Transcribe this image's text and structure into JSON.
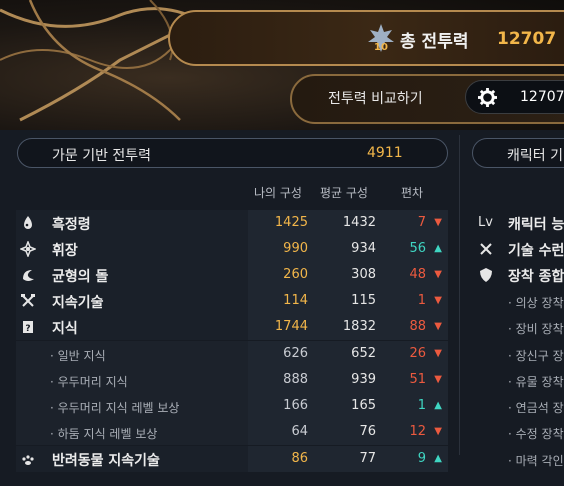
{
  "header": {
    "title_label": "총 전투력",
    "title_value": "12707",
    "emblem_badge": "10",
    "compare_label": "전투력 비교하기",
    "compare_value": "12707"
  },
  "family": {
    "label": "가문 기반 전투력",
    "value": "4911"
  },
  "character": {
    "label": "캐릭터 기"
  },
  "columns": {
    "mine": "나의 구성",
    "avg": "평균 구성",
    "dev": "편차"
  },
  "rows": [
    {
      "name": "흑정령",
      "icon": "spirit-flame-icon",
      "mine": "1425",
      "avg": "1432",
      "dev": "7",
      "dir": "down"
    },
    {
      "name": "휘장",
      "icon": "emblem-icon",
      "mine": "990",
      "avg": "934",
      "dev": "56",
      "dir": "up"
    },
    {
      "name": "균형의 돌",
      "icon": "balance-stone-icon",
      "mine": "260",
      "avg": "308",
      "dev": "48",
      "dir": "down"
    },
    {
      "name": "지속기술",
      "icon": "crossed-tools-icon",
      "mine": "114",
      "avg": "115",
      "dev": "1",
      "dir": "down"
    },
    {
      "name": "지식",
      "icon": "knowledge-book-icon",
      "mine": "1744",
      "avg": "1832",
      "dev": "88",
      "dir": "down"
    }
  ],
  "subrows": [
    {
      "name": "· 일반 지식",
      "mine": "626",
      "avg": "652",
      "dev": "26",
      "dir": "down"
    },
    {
      "name": "· 우두머리 지식",
      "mine": "888",
      "avg": "939",
      "dev": "51",
      "dir": "down"
    },
    {
      "name": "· 우두머리 지식 레벨 보상",
      "mine": "166",
      "avg": "165",
      "dev": "1",
      "dir": "up"
    },
    {
      "name": "· 하둠 지식 레벨 보상",
      "mine": "64",
      "avg": "76",
      "dev": "12",
      "dir": "down"
    }
  ],
  "partial_row": {
    "name": "반려동물 지속기술",
    "icon": "paw-icon",
    "mine": "86",
    "avg": "77",
    "dev": "9",
    "dir": "up"
  },
  "right_rows": [
    {
      "prefix": "Lv",
      "name": "캐릭터 능"
    },
    {
      "icon": "crossed-tools-icon",
      "name": "기술 수런"
    },
    {
      "icon": "shield-icon",
      "name": "장착 종합"
    }
  ],
  "right_subrows": [
    "· 의상 장착",
    "· 장비 장착",
    "· 장신구 장",
    "· 유물 장착",
    "· 연금석 장",
    "· 수정 장착",
    "· 마력 각인"
  ],
  "arrows": {
    "up": "▲",
    "down": "▼"
  }
}
